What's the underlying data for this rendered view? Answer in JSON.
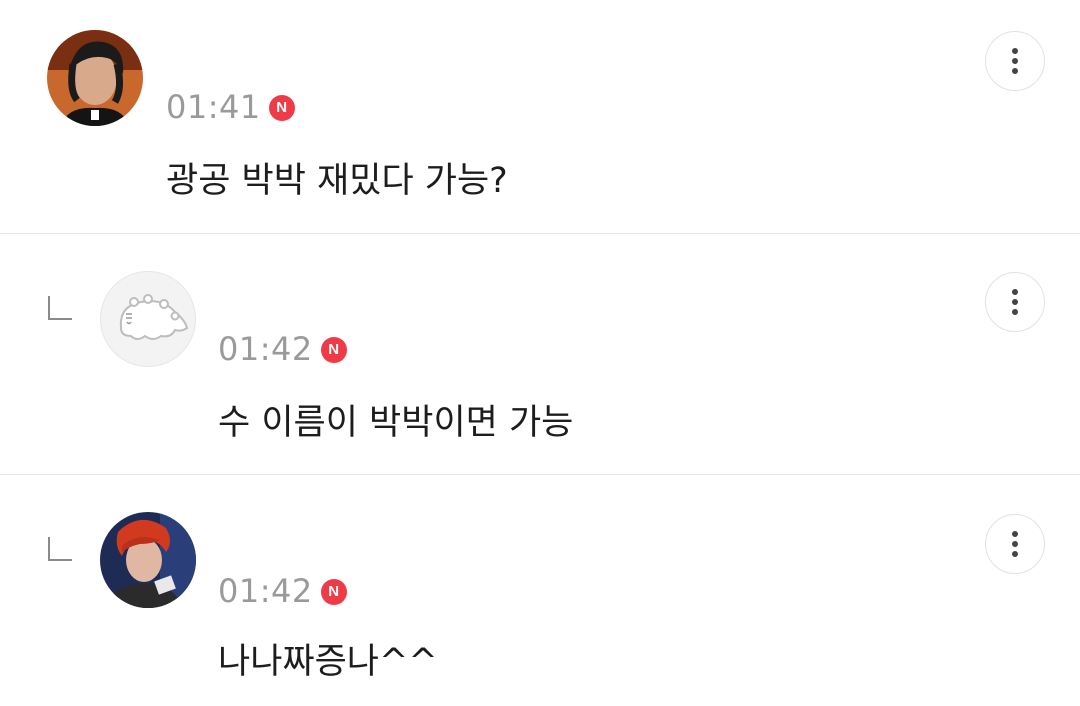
{
  "comments": [
    {
      "time": "01:41",
      "badge": "N",
      "text": "광공 박박 재밌다 가능?",
      "avatar_icon": "user-photo-avatar",
      "is_reply": false
    },
    {
      "time": "01:42",
      "badge": "N",
      "text": "수 이름이 박박이면 가능",
      "avatar_icon": "cartoon-hamster-avatar",
      "is_reply": true
    },
    {
      "time": "01:42",
      "badge": "N",
      "text": "나나짜증나^^",
      "avatar_icon": "user-photo-avatar",
      "is_reply": true
    }
  ],
  "colors": {
    "badge": "#ef3b47",
    "time": "#9a9a9a",
    "divider": "#e6e6e6"
  }
}
